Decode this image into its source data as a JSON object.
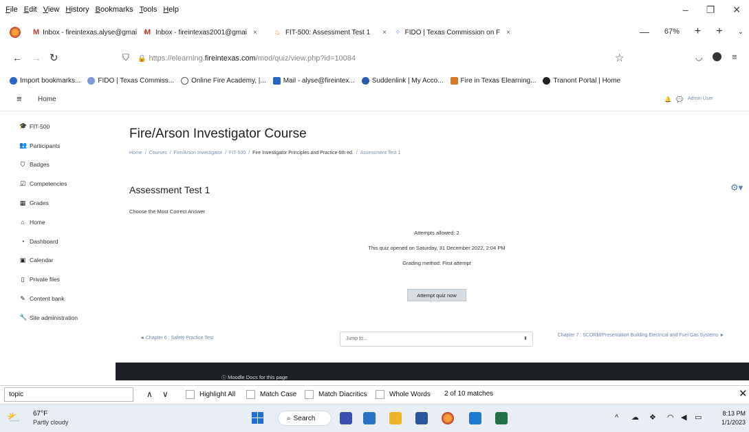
{
  "menu": [
    "File",
    "Edit",
    "View",
    "History",
    "Bookmarks",
    "Tools",
    "Help"
  ],
  "tabs": [
    {
      "label": "Inbox - fireintexas.alyse@gmai",
      "color": "#c8392e"
    },
    {
      "label": "Inbox - fireintexas2001@gmai",
      "color": "#c8392e"
    },
    {
      "label": "FIT-500: Assessment Test 1",
      "color": "#d97a2b"
    },
    {
      "label": "FIDO | Texas Commission on F",
      "color": "#7a9bd6"
    }
  ],
  "tab_close": "×",
  "zoom": "67%",
  "url": {
    "prefix": "https://elearning.",
    "domain": "fireintexas.com",
    "path": "/mod/quiz/view.php?id=10084"
  },
  "bookmarks": [
    {
      "label": "Import bookmarks...",
      "color": "#2a64c8"
    },
    {
      "label": "FIDO | Texas Commiss...",
      "color": "#7a9bd6"
    },
    {
      "label": "Online Fire Academy, |...",
      "color": "#555555"
    },
    {
      "label": "Mail - alyse@fireintex...",
      "color": "#2a64c8"
    },
    {
      "label": "Suddenlink | My Acco...",
      "color": "#2a5bb0"
    },
    {
      "label": "Fire in Texas Elearning...",
      "color": "#d97a2b"
    },
    {
      "label": "Tranont Portal | Home",
      "color": "#222222"
    }
  ],
  "moodle": {
    "home_label": "Home",
    "user_label": "Admin User"
  },
  "sidebar": [
    {
      "icon": "graduation-cap-icon",
      "glyph": "🎓",
      "label": "FIT-500"
    },
    {
      "icon": "users-icon",
      "glyph": "👥",
      "label": "Participants"
    },
    {
      "icon": "shield-icon",
      "glyph": "⛉",
      "label": "Badges"
    },
    {
      "icon": "check-square-icon",
      "glyph": "☑",
      "label": "Competencies"
    },
    {
      "icon": "table-icon",
      "glyph": "▦",
      "label": "Grades"
    },
    {
      "icon": "home-icon",
      "glyph": "⌂",
      "label": "Home"
    },
    {
      "icon": "dashboard-icon",
      "glyph": "◔",
      "label": "Dashboard"
    },
    {
      "icon": "calendar-icon",
      "glyph": "▣",
      "label": "Calendar"
    },
    {
      "icon": "file-icon",
      "glyph": "▯",
      "label": "Private files"
    },
    {
      "icon": "pencil-icon",
      "glyph": "✎",
      "label": "Content bank"
    },
    {
      "icon": "wrench-icon",
      "glyph": "🔧",
      "label": "Site administration"
    }
  ],
  "course_title": "Fire/Arson Investigator Course",
  "breadcrumbs": [
    "Home",
    "Courses",
    "Fire/Arson Investigator",
    "FIT-500",
    "Fire Investigator Principles and Practice 6th ed.",
    "Assessment Test 1"
  ],
  "crumb_sep": "/",
  "quiz": {
    "title": "Assessment Test 1",
    "intro": "Choose the Most Correct Answer",
    "attempts": "Attempts allowed: 2",
    "opened": "This quiz opened on Saturday, 31 December 2022, 2:04 PM",
    "grading": "Grading method: First attempt",
    "button": "Attempt quiz now"
  },
  "nav": {
    "prev": "◄ Chapter 6 : Safety Practice Test",
    "jump_placeholder": "Jump to...",
    "next": "Chapter 7 : SCORM/Presentation Building Electrical and Fuel Gas Systems ►"
  },
  "footer_docs": "Moodle Docs for this page",
  "find": {
    "query": "topic",
    "highlight_all": "Highlight All",
    "match_case": "Match Case",
    "match_diacritics": "Match Diacritics",
    "whole_words": "Whole Words",
    "matches": "2 of 10 matches"
  },
  "taskbar": {
    "temp": "67°F",
    "weather": "Partly cloudy",
    "search": "Search",
    "time": "8:13 PM",
    "date": "1/1/2023"
  }
}
